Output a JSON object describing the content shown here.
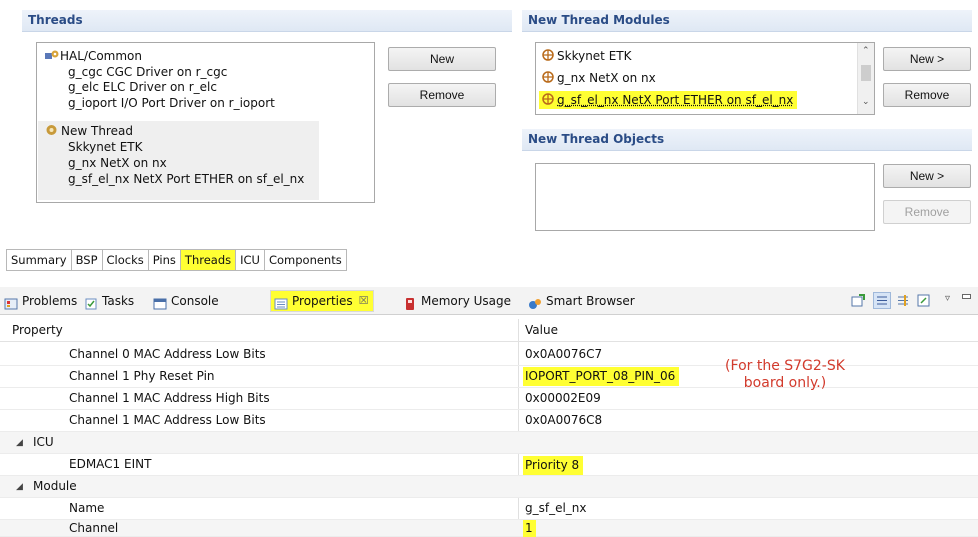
{
  "threads": {
    "header": "Threads",
    "tree": [
      {
        "label": "HAL/Common",
        "level": 0,
        "icon": "hal-common-icon"
      },
      {
        "label": "g_cgc CGC Driver on r_cgc",
        "level": 1
      },
      {
        "label": "g_elc ELC Driver on r_elc",
        "level": 1
      },
      {
        "label": "g_ioport I/O Port Driver on r_ioport",
        "level": 1
      },
      {
        "label": "New Thread",
        "level": 0,
        "icon": "thread-gear-icon"
      },
      {
        "label": "Skkynet ETK",
        "level": 1
      },
      {
        "label": "g_nx NetX on nx",
        "level": 1
      },
      {
        "label": "g_sf_el_nx NetX Port ETHER on sf_el_nx",
        "level": 1
      }
    ],
    "new_label": "New",
    "remove_label": "Remove"
  },
  "modules": {
    "header": "New Thread Modules",
    "items": [
      "Skkynet ETK",
      "g_nx NetX on nx",
      "g_sf_el_nx NetX Port ETHER on sf_el_nx"
    ],
    "new_label": "New >",
    "remove_label": "Remove"
  },
  "objects": {
    "header": "New Thread Objects",
    "new_label": "New >",
    "remove_label": "Remove"
  },
  "config_tabs": [
    "Summary",
    "BSP",
    "Clocks",
    "Pins",
    "Threads",
    "ICU",
    "Components"
  ],
  "active_config_tab": "Threads",
  "views": {
    "problems": "Problems",
    "tasks": "Tasks",
    "console": "Console",
    "properties": "Properties",
    "properties_close": "☒",
    "memory": "Memory Usage",
    "smart_browser": "Smart Browser"
  },
  "properties": {
    "col_property": "Property",
    "col_value": "Value",
    "rows": [
      {
        "name": "Channel 0 MAC Address Low Bits",
        "value": "0x0A0076C7",
        "indent": 2
      },
      {
        "name": "Channel 1 Phy Reset Pin",
        "value": "IOPORT_PORT_08_PIN_06",
        "indent": 2,
        "highlight": true
      },
      {
        "name": "Channel 1 MAC Address High Bits",
        "value": "0x00002E09",
        "indent": 2
      },
      {
        "name": "Channel 1 MAC Address Low Bits",
        "value": "0x0A0076C8",
        "indent": 2
      },
      {
        "name": "ICU",
        "value": "",
        "indent": 1,
        "group": true
      },
      {
        "name": "EDMAC1 EINT",
        "value": "Priority 8",
        "indent": 2,
        "highlight": true
      },
      {
        "name": "Module",
        "value": "",
        "indent": 1,
        "group": true
      },
      {
        "name": "Name",
        "value": "g_sf_el_nx",
        "indent": 2
      },
      {
        "name": "Channel",
        "value": "1",
        "indent": 2,
        "highlight": true
      }
    ]
  },
  "annotation": {
    "line1": "(For the S7G2-SK",
    "line2": "board only.)"
  },
  "colors": {
    "highlight": "#ffff33",
    "header_text": "#2a4c86",
    "annotation": "#d23a2c"
  }
}
